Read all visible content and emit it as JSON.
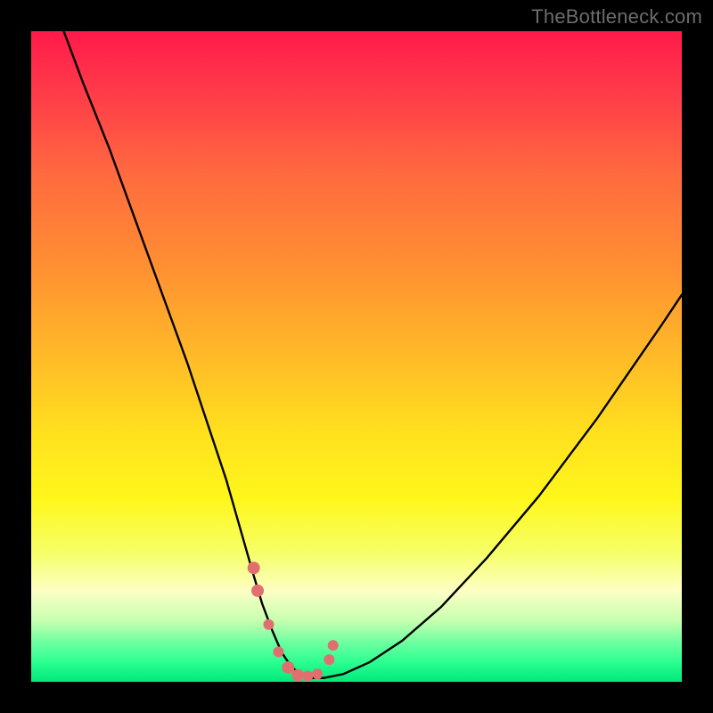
{
  "watermark": "TheBottleneck.com",
  "gradient": {
    "stops": [
      {
        "offset": 0.0,
        "color": "#ff1a4a"
      },
      {
        "offset": 0.1,
        "color": "#ff3d49"
      },
      {
        "offset": 0.22,
        "color": "#ff6a3f"
      },
      {
        "offset": 0.36,
        "color": "#ff8f32"
      },
      {
        "offset": 0.5,
        "color": "#ffba28"
      },
      {
        "offset": 0.62,
        "color": "#ffe11e"
      },
      {
        "offset": 0.72,
        "color": "#fff71c"
      },
      {
        "offset": 0.8,
        "color": "#f6ff66"
      },
      {
        "offset": 0.86,
        "color": "#fdffc4"
      },
      {
        "offset": 0.905,
        "color": "#c8ffb0"
      },
      {
        "offset": 0.94,
        "color": "#6dffa0"
      },
      {
        "offset": 0.97,
        "color": "#2bff91"
      },
      {
        "offset": 1.0,
        "color": "#00e87a"
      }
    ]
  },
  "chart_data": {
    "type": "line",
    "title": "",
    "xlabel": "",
    "ylabel": "",
    "xlim": [
      0,
      100
    ],
    "ylim": [
      0,
      100
    ],
    "series": [
      {
        "name": "curve",
        "x": [
          5,
          8,
          12,
          16,
          20,
          24,
          27,
          30,
          32,
          34,
          35.5,
          37,
          38.5,
          40,
          41.5,
          43,
          45,
          48,
          52,
          57,
          63,
          70,
          78,
          87,
          97,
          100
        ],
        "y": [
          100,
          92,
          82,
          71,
          60,
          49,
          40,
          31,
          24,
          17,
          12,
          8,
          4.5,
          2.3,
          1.1,
          0.6,
          0.6,
          1.2,
          3.0,
          6.3,
          11.5,
          19.0,
          28.5,
          40.5,
          55.0,
          59.5
        ]
      }
    ],
    "markers": {
      "name": "highlight-dots",
      "color": "#e07070",
      "radii": [
        7,
        7,
        6,
        6,
        7,
        7,
        6,
        6,
        6,
        6
      ],
      "x": [
        34.2,
        34.8,
        36.5,
        38.0,
        39.5,
        41.0,
        42.5,
        44.0,
        45.8,
        46.4
      ],
      "y": [
        17.5,
        14.0,
        8.8,
        4.6,
        2.2,
        1.0,
        0.9,
        1.2,
        3.4,
        5.6
      ]
    }
  }
}
